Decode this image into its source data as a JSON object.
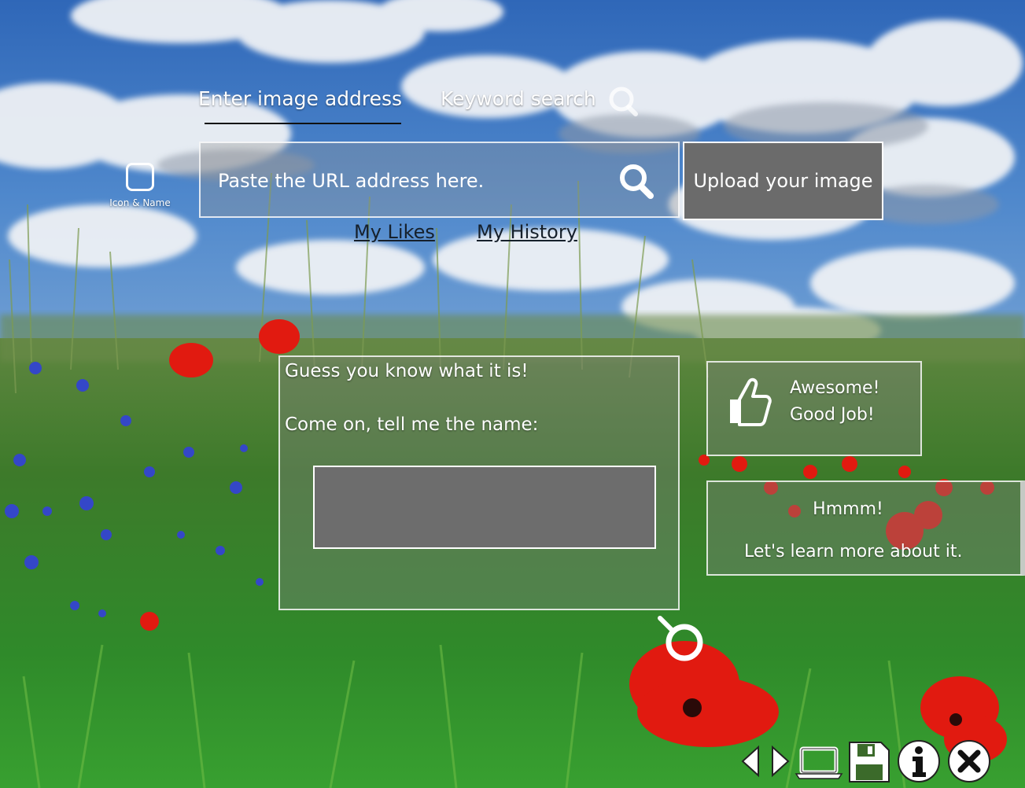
{
  "colors": {
    "upload_bg": "#6b6b6b",
    "answer_box_bg": "#6d6d6d",
    "panel_bg": "rgba(130,130,130,0.38)",
    "link_text": "#16202b",
    "poppy": "#e11a10",
    "cornflower": "#3447c8"
  },
  "tabs": {
    "image_address": "Enter image address",
    "keyword_search": "Keyword search"
  },
  "logo": {
    "label": "Icon & Name"
  },
  "search": {
    "placeholder": "Paste the URL address here."
  },
  "upload": {
    "label": "Upload your image"
  },
  "links": {
    "likes": "My Likes",
    "history": "My History"
  },
  "guess_panel": {
    "line1": "Guess you know what it is!",
    "line2": "Come on, tell me the name:",
    "answer_value": ""
  },
  "feedback_good": {
    "line1": "Awesome!",
    "line2": "Good Job!",
    "icon": "thumbs-up-icon"
  },
  "feedback_learn": {
    "line1": "Hmmm!",
    "line2": "Let's learn more about it."
  },
  "bottom_icons": [
    "arrow-left-icon",
    "arrow-right-icon",
    "laptop-icon",
    "save-icon",
    "info-icon",
    "close-icon"
  ]
}
